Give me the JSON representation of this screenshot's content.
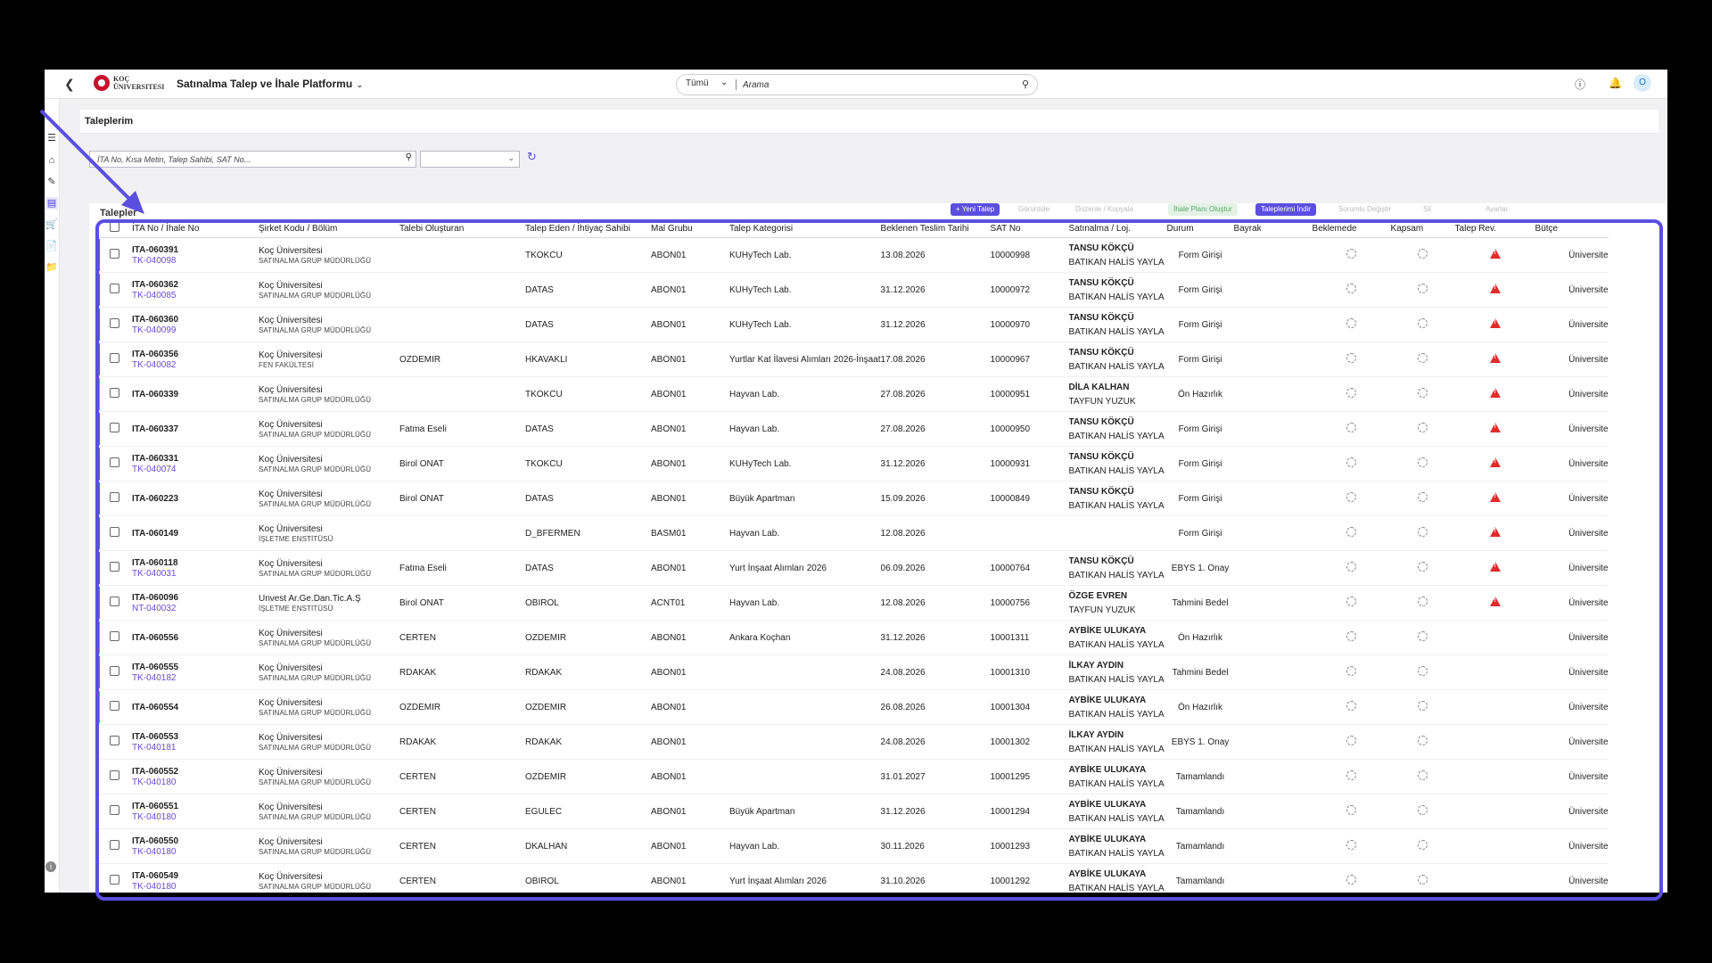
{
  "header": {
    "logo_text": "KOÇ ÜNIVERSITESI",
    "app_title": "Satınalma Talep ve İhale Platformu",
    "search_scope": "Tümü",
    "search_placeholder": "Arama",
    "avatar_initial": "O"
  },
  "page": {
    "title": "Taleplerim",
    "filter_placeholder": "İTA No, Kısa Metin, Talep Sahibi, SAT No...",
    "card_title": "Talepler",
    "toolbar": [
      "+ Yeni Talep",
      "Görüntüle",
      "Düzenle / Kopyala",
      "İhale Planı Oluştur",
      "Taleplerimi İndir",
      "Sorumlu Değiştir",
      "Sil",
      "Ayarlar"
    ]
  },
  "colors": {
    "accent": "#5b4fe0",
    "flag_blue": "#2f6fd6",
    "flag_orange": "#e07a2b",
    "flag_green": "#3a9a48",
    "warn_red": "#e02b2b"
  },
  "table": {
    "columns": [
      "İTA No / İhale No",
      "Şirket Kodu / Bölüm",
      "Talebi Oluşturan",
      "Talep Eden / İhtiyaç Sahibi",
      "Mal Grubu",
      "Talep Kategorisi",
      "Beklenen Teslim Tarihi",
      "SAT No",
      "Satınalma / Loj.",
      "Durum",
      "Bayrak",
      "Beklemede",
      "Kapsam",
      "Talep Rev.",
      "Bütçe"
    ],
    "rows": [
      {
        "flag": "blue",
        "ita": "ITA-060391",
        "tk": "TK-040098",
        "company": "Koç Üniversitesi",
        "dept": "SATINALMA GRUP MÜDÜRLÜĞÜ",
        "creator": "",
        "requester": "TKOKCU",
        "group": "ABON01",
        "category": "KUHyTech Lab.",
        "date": "13.08.2026",
        "sat": "10000998",
        "buyer": "TANSU KÖKÇÜ",
        "loj": "BATIKAN HALİS YAYLA",
        "status": "Form Girişi",
        "warn": true,
        "budget": "Üniversite"
      },
      {
        "flag": "blue",
        "ita": "ITA-060362",
        "tk": "TK-040085",
        "company": "Koç Üniversitesi",
        "dept": "SATINALMA GRUP MÜDÜRLÜĞÜ",
        "creator": "",
        "requester": "DATAS",
        "group": "ABON01",
        "category": "KUHyTech Lab.",
        "date": "31.12.2026",
        "sat": "10000972",
        "buyer": "TANSU KÖKÇÜ",
        "loj": "BATIKAN HALİS YAYLA",
        "status": "Form Girişi",
        "warn": true,
        "budget": "Üniversite"
      },
      {
        "flag": "blue",
        "ita": "ITA-060360",
        "tk": "TK-040099",
        "company": "Koç Üniversitesi",
        "dept": "SATINALMA GRUP MÜDÜRLÜĞÜ",
        "creator": "",
        "requester": "DATAS",
        "group": "ABON01",
        "category": "KUHyTech Lab.",
        "date": "31.12.2026",
        "sat": "10000970",
        "buyer": "TANSU KÖKÇÜ",
        "loj": "BATIKAN HALİS YAYLA",
        "status": "Form Girişi",
        "warn": true,
        "budget": "Üniversite"
      },
      {
        "flag": "blue",
        "ita": "ITA-060356",
        "tk": "TK-040082",
        "company": "Koç Üniversitesi",
        "dept": "FEN FAKÜLTESİ",
        "creator": "OZDEMIR",
        "requester": "HKAVAKLI",
        "group": "ABON01",
        "category": "Yurtlar Kat İlavesi Alımları 2026-İnşaat",
        "date": "17.08.2026",
        "sat": "10000967",
        "buyer": "TANSU KÖKÇÜ",
        "loj": "BATIKAN HALİS YAYLA",
        "status": "Form Girişi",
        "warn": true,
        "budget": "Üniversite"
      },
      {
        "flag": "orange",
        "ita": "ITA-060339",
        "tk": "",
        "company": "Koç Üniversitesi",
        "dept": "SATINALMA GRUP MÜDÜRLÜĞÜ",
        "creator": "",
        "requester": "TKOKCU",
        "group": "ABON01",
        "category": "Hayvan Lab.",
        "date": "27.08.2026",
        "sat": "10000951",
        "buyer": "DİLA KALHAN",
        "loj": "TAYFUN YUZUK",
        "status": "Ön Hazırlık",
        "warn": true,
        "budget": "Üniversite"
      },
      {
        "flag": "blue",
        "ita": "ITA-060337",
        "tk": "",
        "company": "Koç Üniversitesi",
        "dept": "SATINALMA GRUP MÜDÜRLÜĞÜ",
        "creator": "Fatma Eseli",
        "requester": "DATAS",
        "group": "ABON01",
        "category": "Hayvan Lab.",
        "date": "27.08.2026",
        "sat": "10000950",
        "buyer": "TANSU KÖKÇÜ",
        "loj": "BATIKAN HALİS YAYLA",
        "status": "Form Girişi",
        "warn": true,
        "budget": "Üniversite"
      },
      {
        "flag": "blue",
        "ita": "ITA-060331",
        "tk": "TK-040074",
        "company": "Koç Üniversitesi",
        "dept": "SATINALMA GRUP MÜDÜRLÜĞÜ",
        "creator": "Birol ONAT",
        "requester": "TKOKCU",
        "group": "ABON01",
        "category": "KUHyTech Lab.",
        "date": "31.12.2026",
        "sat": "10000931",
        "buyer": "TANSU KÖKÇÜ",
        "loj": "BATIKAN HALİS YAYLA",
        "status": "Form Girişi",
        "warn": true,
        "budget": "Üniversite"
      },
      {
        "flag": "blue",
        "ita": "ITA-060223",
        "tk": "",
        "company": "Koç Üniversitesi",
        "dept": "SATINALMA GRUP MÜDÜRLÜĞÜ",
        "creator": "Birol ONAT",
        "requester": "DATAS",
        "group": "ABON01",
        "category": "Büyük Apartman",
        "date": "15.09.2026",
        "sat": "10000849",
        "buyer": "TANSU KÖKÇÜ",
        "loj": "BATIKAN HALİS YAYLA",
        "status": "Form Girişi",
        "warn": true,
        "budget": "Üniversite"
      },
      {
        "flag": "blue",
        "ita": "ITA-060149",
        "tk": "",
        "company": "Koç Üniversitesi",
        "dept": "İŞLETME ENSTİTÜSÜ",
        "creator": "",
        "requester": "D_BFERMEN",
        "group": "BASM01",
        "category": "Hayvan Lab.",
        "date": "12.08.2026",
        "sat": "",
        "buyer": "",
        "loj": "",
        "status": "Form Girişi",
        "warn": true,
        "budget": "Üniversite"
      },
      {
        "flag": "blue",
        "ita": "ITA-060118",
        "tk": "TK-040031",
        "company": "Koç Üniversitesi",
        "dept": "SATINALMA GRUP MÜDÜRLÜĞÜ",
        "creator": "Fatma Eseli",
        "requester": "DATAS",
        "group": "ABON01",
        "category": "Yurt İnşaat Alımları 2026",
        "date": "06.09.2026",
        "sat": "10000764",
        "buyer": "TANSU KÖKÇÜ",
        "loj": "BATIKAN HALİS YAYLA",
        "status": "EBYS 1. Onay",
        "warn": true,
        "budget": "Üniversite"
      },
      {
        "flag": "green",
        "ita": "ITA-060096",
        "tk": "NT-040032",
        "company": "Unvest Ar.Ge.Dan.Tic.A.Ş",
        "dept": "İŞLETME ENSTİTÜSÜ",
        "creator": "Birol ONAT",
        "requester": "OBIROL",
        "group": "ACNT01",
        "category": "Hayvan Lab.",
        "date": "12.08.2026",
        "sat": "10000756",
        "buyer": "ÖZGE EVREN",
        "loj": "TAYFUN YUZUK",
        "status": "Tahmini Bedel",
        "warn": true,
        "budget": "Üniversite"
      },
      {
        "flag": "orange",
        "ita": "ITA-060556",
        "tk": "",
        "company": "Koç Üniversitesi",
        "dept": "SATINALMA GRUP MÜDÜRLÜĞÜ",
        "creator": "CERTEN",
        "requester": "OZDEMIR",
        "group": "ABON01",
        "category": "Ankara Koçhan",
        "date": "31.12.2026",
        "sat": "10001311",
        "buyer": "AYBİKE ULUKAYA",
        "loj": "BATIKAN HALİS YAYLA",
        "status": "Ön Hazırlık",
        "warn": false,
        "budget": "Üniversite"
      },
      {
        "flag": "green",
        "ita": "ITA-060555",
        "tk": "TK-040182",
        "company": "Koç Üniversitesi",
        "dept": "SATINALMA GRUP MÜDÜRLÜĞÜ",
        "creator": "RDAKAK",
        "requester": "RDAKAK",
        "group": "ABON01",
        "category": "",
        "date": "24.08.2026",
        "sat": "10001310",
        "buyer": "İLKAY AYDIN",
        "loj": "BATIKAN HALİS YAYLA",
        "status": "Tahmini Bedel",
        "warn": false,
        "budget": "Üniversite"
      },
      {
        "flag": "orange",
        "ita": "ITA-060554",
        "tk": "",
        "company": "Koç Üniversitesi",
        "dept": "SATINALMA GRUP MÜDÜRLÜĞÜ",
        "creator": "OZDEMIR",
        "requester": "OZDEMIR",
        "group": "ABON01",
        "category": "",
        "date": "26.08.2026",
        "sat": "10001304",
        "buyer": "AYBİKE ULUKAYA",
        "loj": "BATIKAN HALİS YAYLA",
        "status": "Ön Hazırlık",
        "warn": false,
        "budget": "Üniversite"
      },
      {
        "flag": "none",
        "ita": "ITA-060553",
        "tk": "TK-040181",
        "company": "Koç Üniversitesi",
        "dept": "SATINALMA GRUP MÜDÜRLÜĞÜ",
        "creator": "RDAKAK",
        "requester": "RDAKAK",
        "group": "ABON01",
        "category": "",
        "date": "24.08.2026",
        "sat": "10001302",
        "buyer": "İLKAY AYDIN",
        "loj": "BATIKAN HALİS YAYLA",
        "status": "EBYS 1. Onay",
        "warn": false,
        "budget": "Üniversite"
      },
      {
        "flag": "none",
        "ita": "ITA-060552",
        "tk": "TK-040180",
        "company": "Koç Üniversitesi",
        "dept": "SATINALMA GRUP MÜDÜRLÜĞÜ",
        "creator": "CERTEN",
        "requester": "OZDEMIR",
        "group": "ABON01",
        "category": "",
        "date": "31.01.2027",
        "sat": "10001295",
        "buyer": "AYBİKE ULUKAYA",
        "loj": "BATIKAN HALİS YAYLA",
        "status": "Tamamlandı",
        "warn": false,
        "budget": "Üniversite"
      },
      {
        "flag": "none",
        "ita": "ITA-060551",
        "tk": "TK-040180",
        "company": "Koç Üniversitesi",
        "dept": "SATINALMA GRUP MÜDÜRLÜĞÜ",
        "creator": "CERTEN",
        "requester": "EGULEC",
        "group": "ABON01",
        "category": "Büyük Apartman",
        "date": "31.12.2026",
        "sat": "10001294",
        "buyer": "AYBİKE ULUKAYA",
        "loj": "BATIKAN HALİS YAYLA",
        "status": "Tamamlandı",
        "warn": false,
        "budget": "Üniversite"
      },
      {
        "flag": "none",
        "ita": "ITA-060550",
        "tk": "TK-040180",
        "company": "Koç Üniversitesi",
        "dept": "SATINALMA GRUP MÜDÜRLÜĞÜ",
        "creator": "CERTEN",
        "requester": "DKALHAN",
        "group": "ABON01",
        "category": "Hayvan Lab.",
        "date": "30.11.2026",
        "sat": "10001293",
        "buyer": "AYBİKE ULUKAYA",
        "loj": "BATIKAN HALİS YAYLA",
        "status": "Tamamlandı",
        "warn": false,
        "budget": "Üniversite"
      },
      {
        "flag": "none",
        "ita": "ITA-060549",
        "tk": "TK-040180",
        "company": "Koç Üniversitesi",
        "dept": "SATINALMA GRUP MÜDÜRLÜĞÜ",
        "creator": "CERTEN",
        "requester": "OBIROL",
        "group": "ABON01",
        "category": "Yurt İnşaat Alımları 2026",
        "date": "31.10.2026",
        "sat": "10001292",
        "buyer": "AYBİKE ULUKAYA",
        "loj": "BATIKAN HALİS YAYLA",
        "status": "Tamamlandı",
        "warn": false,
        "budget": "Üniversite"
      }
    ]
  }
}
